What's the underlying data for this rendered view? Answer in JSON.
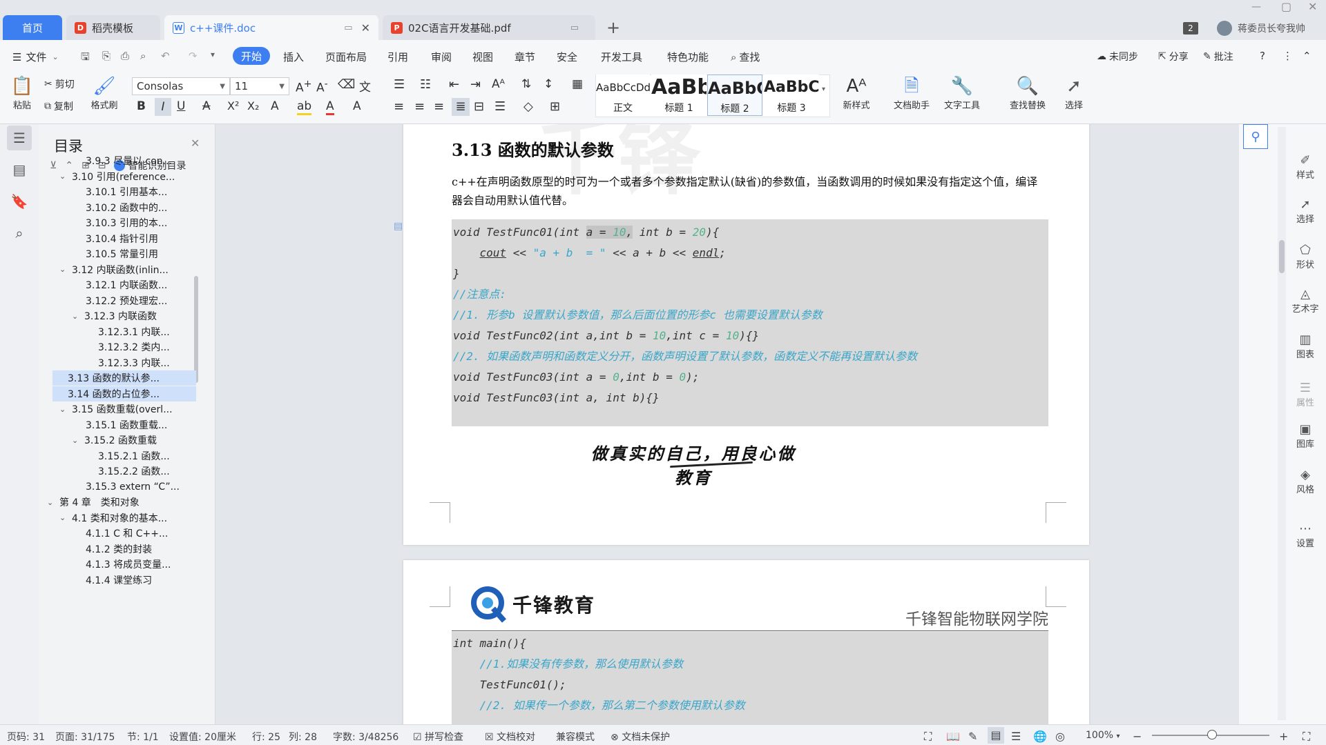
{
  "tabs": {
    "home": "首页",
    "daoke": "稻壳模板",
    "doc": "c++课件.doc",
    "pdf": "02C语言开发基础.pdf",
    "count": "2",
    "user": "蒋委员长夸我帅"
  },
  "menu": {
    "file": "文件",
    "items": [
      "开始",
      "插入",
      "页面布局",
      "引用",
      "审阅",
      "视图",
      "章节",
      "安全",
      "开发工具",
      "特色功能"
    ],
    "search": "查找",
    "sync": "未同步",
    "share": "分享",
    "comment": "批注"
  },
  "ribbon": {
    "paste": "粘贴",
    "cut": "剪切",
    "copy": "复制",
    "format_painter": "格式刷",
    "font_name": "Consolas",
    "font_size": "11",
    "styles": [
      {
        "sample": "AaBbCcDd",
        "label": "正文"
      },
      {
        "sample": "AaBb",
        "label": "标题 1"
      },
      {
        "sample": "AaBbC",
        "label": "标题 2"
      },
      {
        "sample": "AaBbC",
        "label": "标题 3"
      }
    ],
    "new_style": "新样式",
    "doc_assistant": "文档助手",
    "text_tools": "文字工具",
    "find_replace": "查找替换",
    "select": "选择"
  },
  "toc": {
    "title": "目录",
    "smart": "智能识别目录",
    "items": [
      {
        "text": "3.9.3 尽量以 con...",
        "caret": ""
      },
      {
        "text": "3.10 引用(reference...",
        "caret": "v"
      },
      {
        "text": "3.10.1 引用基本...",
        "caret": ""
      },
      {
        "text": "3.10.2 函数中的...",
        "caret": ""
      },
      {
        "text": "3.10.3 引用的本...",
        "caret": ""
      },
      {
        "text": "3.10.4 指针引用",
        "caret": ""
      },
      {
        "text": "3.10.5 常量引用",
        "caret": ""
      },
      {
        "text": "3.12 内联函数(inlin...",
        "caret": "v"
      },
      {
        "text": "3.12.1 内联函数...",
        "caret": ""
      },
      {
        "text": "3.12.2 预处理宏...",
        "caret": ""
      },
      {
        "text": "3.12.3 内联函数",
        "caret": "v"
      },
      {
        "text": "3.12.3.1 内联...",
        "caret": ""
      },
      {
        "text": "3.12.3.2 类内...",
        "caret": ""
      },
      {
        "text": "3.12.3.3 内联...",
        "caret": ""
      },
      {
        "text": "3.13 函数的默认参...",
        "caret": ""
      },
      {
        "text": "3.14 函数的占位参...",
        "caret": ""
      },
      {
        "text": "3.15 函数重载(overl...",
        "caret": "v"
      },
      {
        "text": "3.15.1 函数重载...",
        "caret": ""
      },
      {
        "text": "3.15.2 函数重载",
        "caret": "v"
      },
      {
        "text": "3.15.2.1 函数...",
        "caret": ""
      },
      {
        "text": "3.15.2.2 函数...",
        "caret": ""
      },
      {
        "text": "3.15.3 extern “C”...",
        "caret": ""
      },
      {
        "text": "第 4 章　类和对象",
        "caret": "v"
      },
      {
        "text": "4.1 类和对象的基本...",
        "caret": "v"
      },
      {
        "text": "4.1.1 C 和 C++...",
        "caret": ""
      },
      {
        "text": "4.1.2 类的封装",
        "caret": ""
      },
      {
        "text": "4.1.3 将成员变量...",
        "caret": ""
      },
      {
        "text": "4.1.4 课堂练习",
        "caret": ""
      }
    ]
  },
  "doc": {
    "heading": "3.13  函数的默认参数",
    "para": "c++在声明函数原型的时可为一个或者多个参数指定默认(缺省)的参数值，当函数调用的时候如果没有指定这个值，编译器会自动用默认值代替。",
    "code1": [
      "void TestFunc01(int a = 10, int b = 20){",
      "    cout << \"a + b  = \" << a + b << endl;",
      "}",
      "//注意点:",
      "//1. 形参b 设置默认参数值，那么后面位置的形参c 也需要设置默认参数",
      "void TestFunc02(int a,int b = 10,int c = 10){}",
      "//2. 如果函数声明和函数定义分开，函数声明设置了默认参数，函数定义不能再设置默认参数",
      "void TestFunc03(int a = 0,int b = 0);",
      "void TestFunc03(int a, int b){}"
    ],
    "slogan": "做真实的自己，用良心做教育",
    "logo_text": "千锋教育",
    "header_right": "千锋智能物联网学院",
    "code2": [
      "int main(){",
      "    //1.如果没有传参数，那么使用默认参数",
      "    TestFunc01();",
      "    //2. 如果传一个参数，那么第二个参数使用默认参数"
    ]
  },
  "rightbar": [
    "样式",
    "选择",
    "形状",
    "艺术字",
    "图表",
    "属性",
    "图库",
    "风格",
    "设置"
  ],
  "status": {
    "page_no": "页码: 31",
    "pages": "页面: 31/175",
    "section": "节: 1/1",
    "setting": "设置值: 20厘米",
    "row": "行: 25",
    "col": "列: 28",
    "words": "字数: 3/48256",
    "spell": "拼写检查",
    "proof": "文档校对",
    "compat": "兼容模式",
    "protect": "文档未保护",
    "zoom": "100%"
  }
}
